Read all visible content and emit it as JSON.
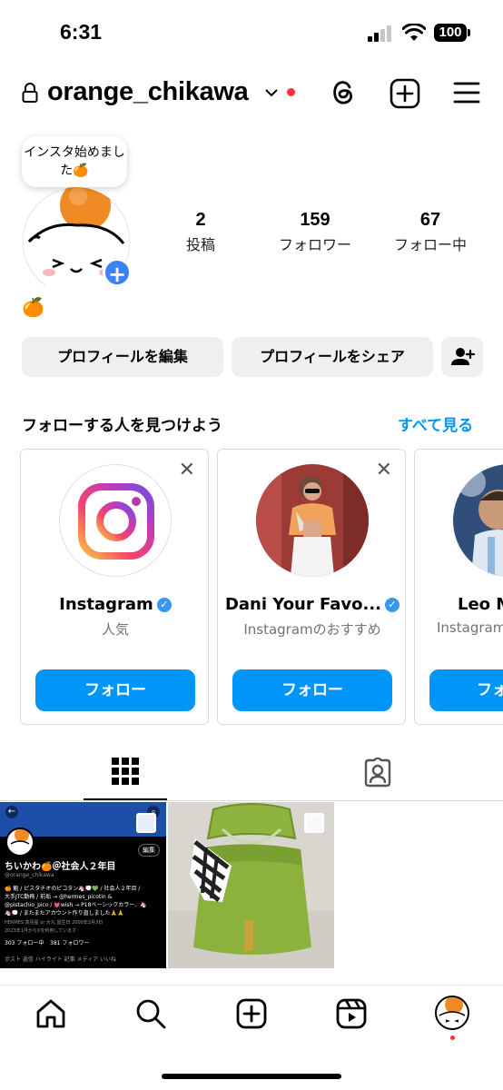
{
  "status_bar": {
    "time": "6:31",
    "battery": "100"
  },
  "header": {
    "username": "orange_chikawa"
  },
  "profile": {
    "bubble_text": "インスタ始めました🍊",
    "bio_emoji": "🍊",
    "stats": [
      {
        "value": "2",
        "label": "投稿"
      },
      {
        "value": "159",
        "label": "フォロワー"
      },
      {
        "value": "67",
        "label": "フォロー中"
      }
    ]
  },
  "actions": {
    "edit_label": "プロフィールを編集",
    "share_label": "プロフィールをシェア"
  },
  "suggestions": {
    "title": "フォローする人を見つけよう",
    "see_all": "すべて見る",
    "cards": [
      {
        "name": "Instagram",
        "sub": "人気",
        "button": "フォロー"
      },
      {
        "name": "Dani Your Favo...",
        "sub": "Instagramのおすすめ",
        "button": "フォロー"
      },
      {
        "name": "Leo M",
        "sub": "Instagram",
        "button": "フォ"
      }
    ]
  },
  "posts": {
    "post1": {
      "display_name": "ちいかわ🍊＠社会人２年目",
      "handle": "@orange_chikawa",
      "edit": "編集",
      "bio_line1": "🍊 鮨 / ピスタチオのピコタン🦄💭💚 / 社会人２年目 /",
      "bio_line2": "大手JTC勤務 / 前垢 → @hermes_picotin &",
      "bio_line3": "@pistachio_pico / 💓wish → P18ベーシックカラー、🦄",
      "bio_line4": "🦄💭 / またまたアカウント作り直しました🙏🙏",
      "meta_line1": "HERMES 高島屋 or 大丸   誕生日  2000年3月3日",
      "meta_line2": "2023年1月からXを利用しています",
      "following": "303 フォロー中",
      "followers": "381 フォロワー",
      "tabs": "ポスト  返信  ハイライト  記事  メディア  いいね"
    }
  },
  "colors": {
    "accent": "#0095f6",
    "notification": "#ff3040",
    "badge": "#3b82f6"
  }
}
